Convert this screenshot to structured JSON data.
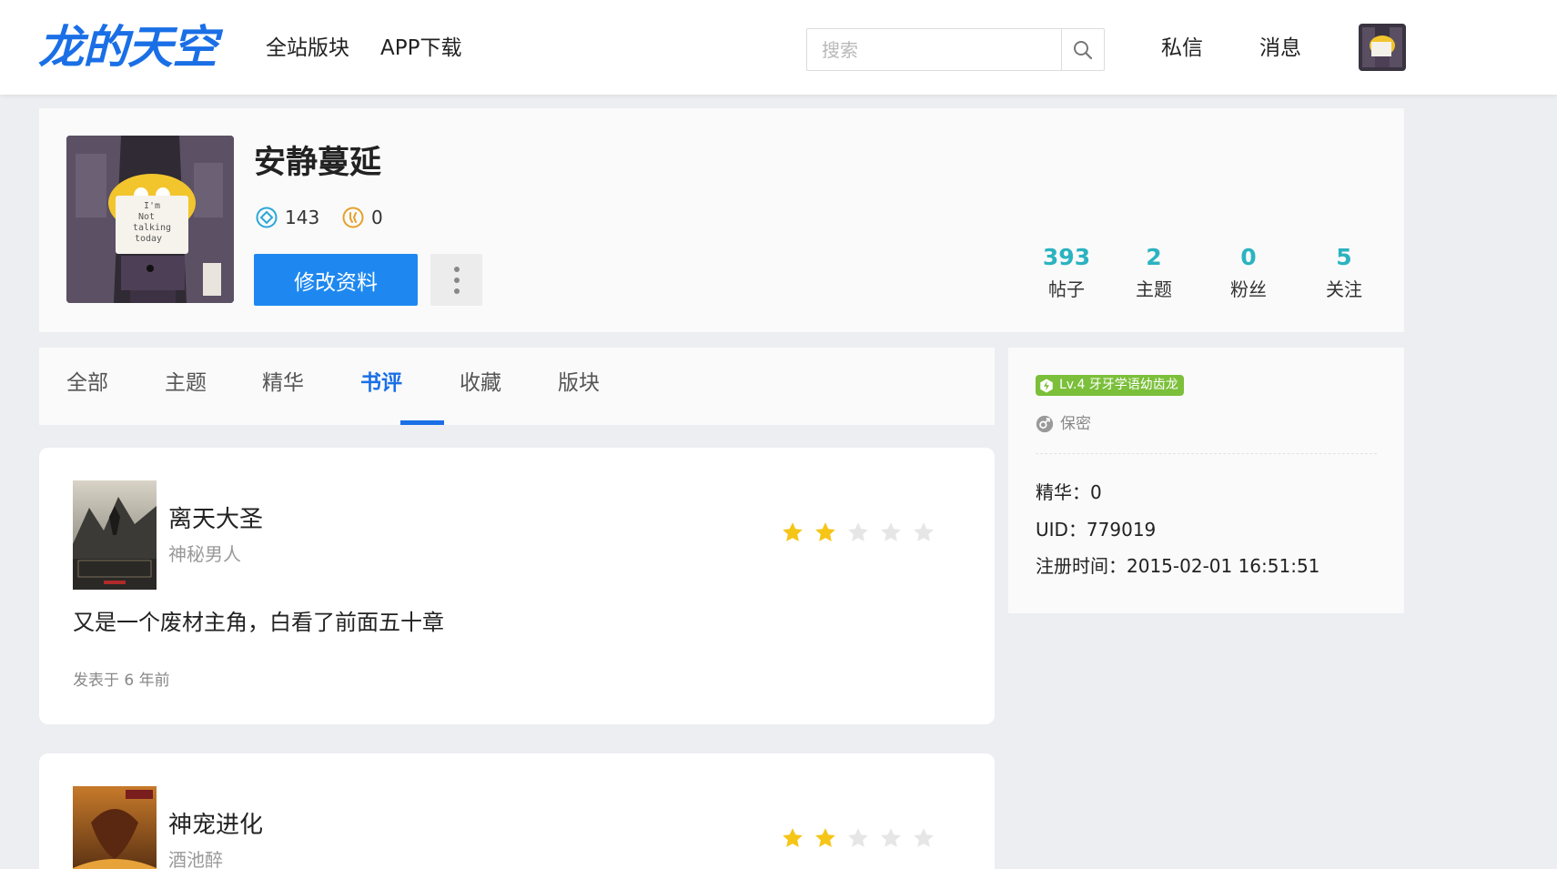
{
  "header": {
    "logo": "龙的天空",
    "nav": [
      "全站版块",
      "APP下载"
    ],
    "search_placeholder": "搜索",
    "messages_label": "私信",
    "notifications_label": "消息"
  },
  "profile": {
    "username": "安静蔓延",
    "points": "143",
    "coins": "0",
    "edit_label": "修改资料",
    "avatar_sign_text": "I'm Not talking today",
    "counters": [
      {
        "num": "393",
        "label": "帖子"
      },
      {
        "num": "2",
        "label": "主题"
      },
      {
        "num": "0",
        "label": "粉丝"
      },
      {
        "num": "5",
        "label": "关注"
      }
    ]
  },
  "tabs": [
    "全部",
    "主题",
    "精华",
    "书评",
    "收藏",
    "版块"
  ],
  "active_tab": "书评",
  "reviews": [
    {
      "title": "离天大圣",
      "author": "神秘男人",
      "rating": 2,
      "text": "又是一个废材主角，白看了前面五十章",
      "meta": "发表于 6 年前"
    },
    {
      "title": "神宠进化",
      "author": "酒池醉",
      "rating": 2
    }
  ],
  "sidebar": {
    "level": "Lv.4 牙牙学语幼齿龙",
    "gender": "保密",
    "essence": "精华：0",
    "uid": "UID：779019",
    "registered": "注册时间：2015-02-01 16:51:51"
  },
  "colors": {
    "brand_blue": "#1a6fe6",
    "button_blue": "#1e88f0",
    "counter_teal": "#2bb3c0",
    "star_gold": "#f5c518",
    "level_green": "#7bbf3a"
  }
}
